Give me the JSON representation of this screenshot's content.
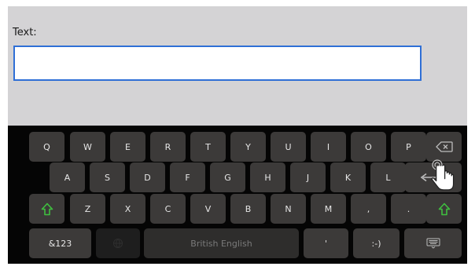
{
  "form": {
    "label": "Text:",
    "input_value": "",
    "input_placeholder": ""
  },
  "keyboard": {
    "row1": [
      "Q",
      "W",
      "E",
      "R",
      "T",
      "Y",
      "U",
      "I",
      "O",
      "P"
    ],
    "row2": [
      "A",
      "S",
      "D",
      "F",
      "G",
      "H",
      "J",
      "K",
      "L"
    ],
    "row3": [
      "Z",
      "X",
      "C",
      "V",
      "B",
      "N",
      "M",
      ",",
      "."
    ],
    "symbols_label": "&123",
    "space_label": "British English",
    "apostrophe_label": "'",
    "smiley_label": ":-)",
    "icons": {
      "backspace": "backspace-icon",
      "enter": "enter-arrow-icon",
      "shift": "shift-arrow-icon",
      "hide": "hide-keyboard-icon",
      "globe": "globe-icon"
    },
    "accent_color": "#3fbf3f",
    "focus_color": "#2f6fd6"
  }
}
